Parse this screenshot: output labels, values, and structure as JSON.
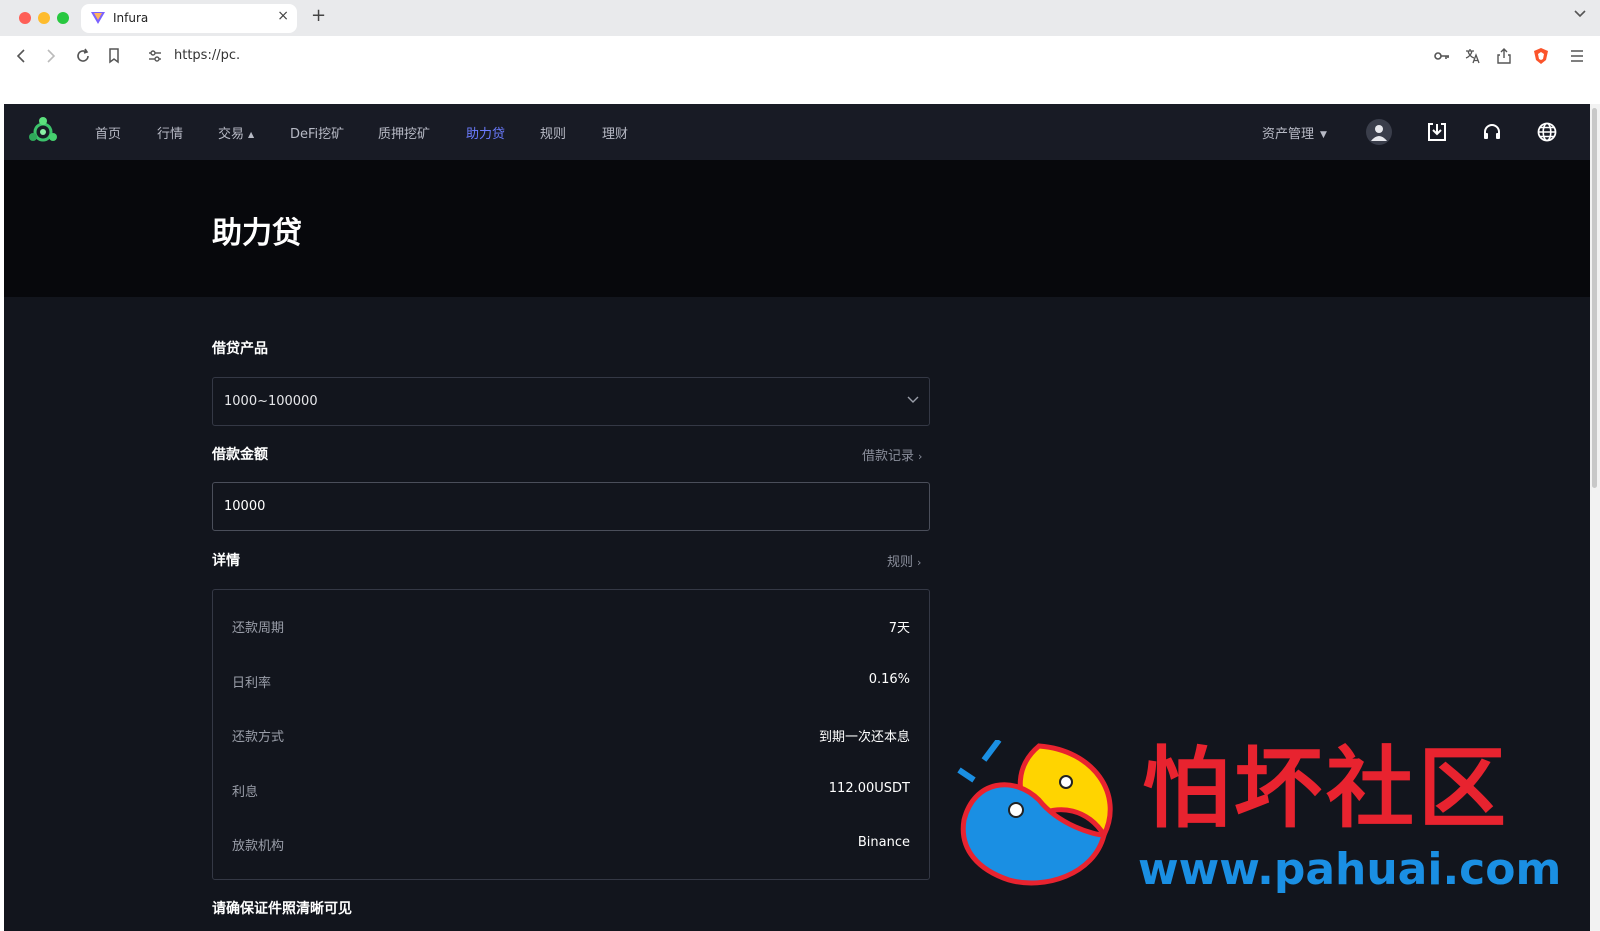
{
  "browser": {
    "tab_title": "Infura",
    "new_tab": "+",
    "close": "×",
    "url": "https://pc."
  },
  "nav": {
    "items": [
      {
        "label": "首页"
      },
      {
        "label": "行情"
      },
      {
        "label": "交易",
        "has_caret": true
      },
      {
        "label": "DeFi挖矿"
      },
      {
        "label": "质押挖矿"
      },
      {
        "label": "助力贷",
        "active": true
      },
      {
        "label": "规则"
      },
      {
        "label": "理财"
      }
    ],
    "asset_menu": "资产管理",
    "icons": [
      "user-icon",
      "download-icon",
      "headset-icon",
      "globe-icon"
    ],
    "active_color": "#6b7cff"
  },
  "page": {
    "title": "助力贷"
  },
  "form": {
    "product_label": "借贷产品",
    "product_value": "1000~100000",
    "amount_label": "借款金额",
    "loan_record_link": "借款记录",
    "amount_value": "10000",
    "details_label": "详情",
    "rules_link": "规则",
    "details": [
      {
        "label": "还款周期",
        "value": "7天"
      },
      {
        "label": "日利率",
        "value": "0.16%"
      },
      {
        "label": "还款方式",
        "value": "到期一次还本息"
      },
      {
        "label": "利息",
        "value": "112.00USDT"
      },
      {
        "label": "放款机构",
        "value": "Binance"
      }
    ],
    "cut_off_text": "请确保证件照清晰可见"
  },
  "watermark": {
    "text_cn": "怕坏社区",
    "text_url": "www.pahuai.com",
    "colors": {
      "red": "#e8232f",
      "blue": "#1a8fe3",
      "yellow": "#ffd400"
    }
  }
}
